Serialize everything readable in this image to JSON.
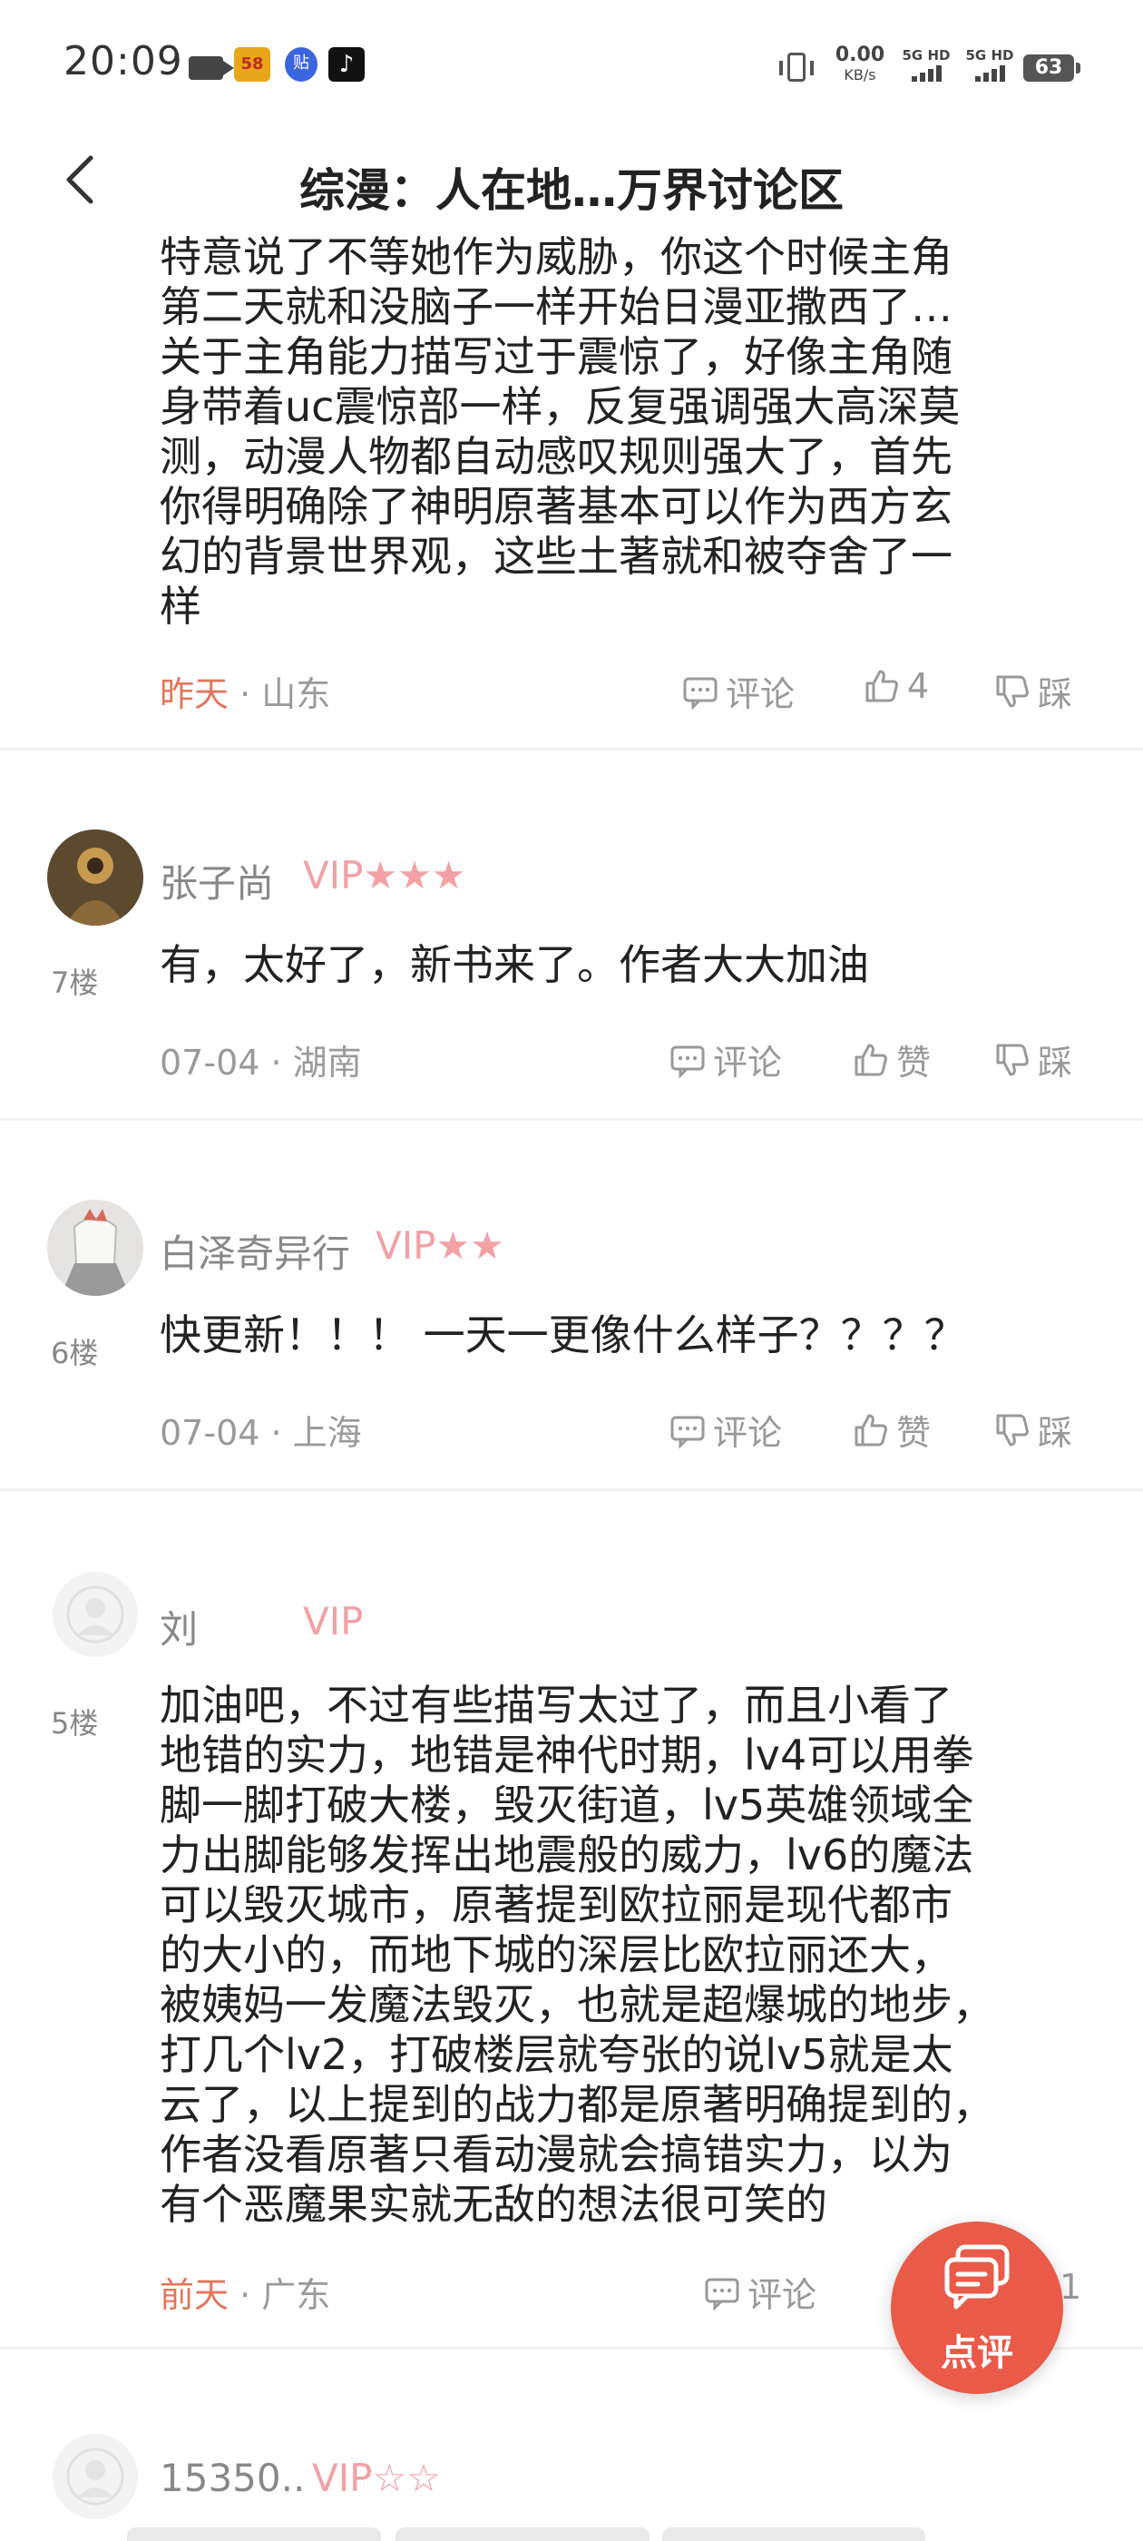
{
  "status_bar": {
    "time": "20:09",
    "app_58": "58",
    "app_tieba": "贴",
    "app_tiktok": "♪",
    "net_speed": "0.00",
    "net_unit": "KB/s",
    "sim1": "5G HD",
    "sim2": "5G HD",
    "battery": "63"
  },
  "header": {
    "title": "综漫：人在地…万界讨论区"
  },
  "comments": [
    {
      "lines": [
        "特意说了不等她作为威胁，你这个时候主角",
        "第二天就和没脑子一样开始日漫亚撒西了…",
        "关于主角能力描写过于震惊了，好像主角随",
        "身带着uc震惊部一样，反复强调强大高深莫",
        "测，动漫人物都自动感叹规则强大了，首先",
        "你得明确除了神明原著基本可以作为西方玄",
        "幻的背景世界观，这些土著就和被夺舍了一",
        "样"
      ],
      "date": "昨天",
      "location": "· 山东",
      "comment_label": "评论",
      "like_label": "4",
      "dislike_label": "踩"
    },
    {
      "username": "张子尚",
      "vip": "VIP★★★",
      "floor": "7楼",
      "lines": [
        "有，太好了，新书来了。作者大大加油"
      ],
      "date": "07-04 · 湖南",
      "comment_label": "评论",
      "like_label": "赞",
      "dislike_label": "踩"
    },
    {
      "username": "白泽奇异行",
      "vip": "VIP★★",
      "floor": "6楼",
      "lines": [
        "快更新！！！ 一天一更像什么样子？？？？"
      ],
      "date": "07-04 · 上海",
      "comment_label": "评论",
      "like_label": "赞",
      "dislike_label": "踩"
    },
    {
      "username": "刘",
      "vip": "VIP",
      "floor": "5楼",
      "lines": [
        "加油吧，不过有些描写太过了，而且小看了",
        "地错的实力，地错是神代时期，lv4可以用拳",
        "脚一脚打破大楼，毁灭街道，lv5英雄领域全",
        "力出脚能够发挥出地震般的威力，lv6的魔法",
        "可以毁灭城市，原著提到欧拉丽是现代都市",
        "的大小的，而地下城的深层比欧拉丽还大，",
        "被姨妈一发魔法毁灭，也就是超爆城的地步，",
        "打几个lv2，打破楼层就夸张的说lv5就是太",
        "云了，以上提到的战力都是原著明确提到的，",
        "作者没看原著只看动漫就会搞错实力，以为",
        "有个恶魔果实就无敌的想法很可笑的"
      ],
      "date": "前天",
      "location": "· 广东",
      "comment_label": "评论",
      "like_label": "1"
    },
    {
      "username": "15350..",
      "vip": "VIP☆☆"
    }
  ],
  "fab": {
    "label": "点评"
  }
}
